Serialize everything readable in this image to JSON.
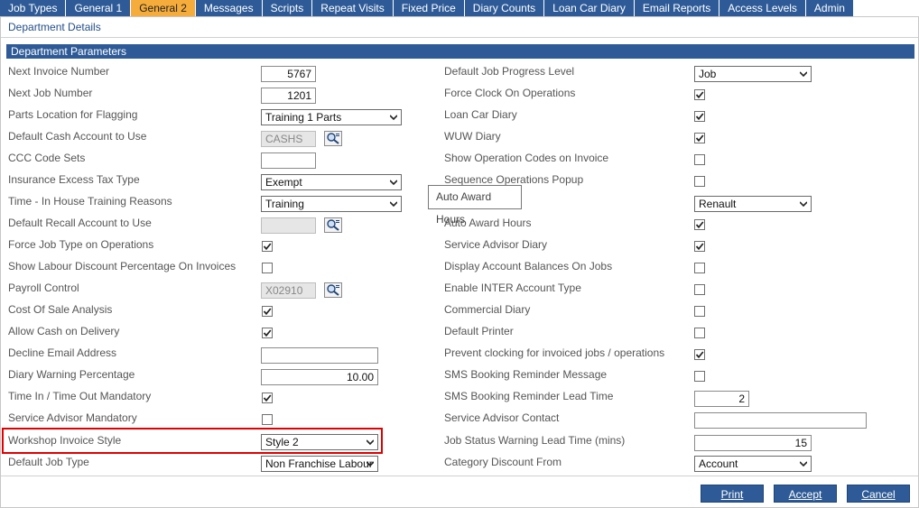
{
  "tabs": [
    "Job Types",
    "General 1",
    "General 2",
    "Messages",
    "Scripts",
    "Repeat Visits",
    "Fixed Price",
    "Diary Counts",
    "Loan Car Diary",
    "Email Reports",
    "Access Levels",
    "Admin"
  ],
  "panel_title": "Department Details",
  "section_title": "Department Parameters",
  "left": {
    "next_invoice_number": {
      "label": "Next Invoice Number",
      "value": "5767"
    },
    "next_job_number": {
      "label": "Next Job Number",
      "value": "1201"
    },
    "parts_location": {
      "label": "Parts Location for Flagging",
      "value": "Training 1 Parts"
    },
    "default_cash_account": {
      "label": "Default Cash Account to Use",
      "value": "CASHS"
    },
    "ccc_code_sets": {
      "label": "CCC Code Sets",
      "value": ""
    },
    "insurance_excess_tax": {
      "label": "Insurance Excess Tax Type",
      "value": "Exempt"
    },
    "time_in_house": {
      "label": "Time - In House Training Reasons",
      "value": "Training"
    },
    "default_recall_account": {
      "label": "Default Recall Account to Use",
      "value": ""
    },
    "force_job_type": {
      "label": "Force Job Type on Operations",
      "checked": true
    },
    "show_labour_discount": {
      "label": "Show Labour Discount Percentage On Invoices",
      "checked": false
    },
    "payroll_control": {
      "label": "Payroll Control",
      "value": "X02910"
    },
    "cost_of_sale": {
      "label": "Cost Of Sale Analysis",
      "checked": true
    },
    "allow_cash_on_delivery": {
      "label": "Allow Cash on Delivery",
      "checked": true
    },
    "decline_email": {
      "label": "Decline Email Address",
      "value": ""
    },
    "diary_warning": {
      "label": "Diary Warning Percentage",
      "value": "10.00"
    },
    "time_in_out": {
      "label": "Time In / Time Out Mandatory",
      "checked": true
    },
    "service_advisor_mandatory": {
      "label": "Service Advisor Mandatory",
      "checked": false
    },
    "workshop_invoice_style": {
      "label": "Workshop Invoice Style",
      "value": "Style 2"
    },
    "default_job_type": {
      "label": "Default Job Type",
      "value": "Non Franchise Labour"
    }
  },
  "right": {
    "default_job_progress": {
      "label": "Default Job Progress Level",
      "value": "Job"
    },
    "force_clock_on": {
      "label": "Force Clock On Operations",
      "checked": true
    },
    "loan_car_diary": {
      "label": "Loan Car Diary",
      "checked": true
    },
    "wuw_diary": {
      "label": "WUW Diary",
      "checked": true
    },
    "show_operation_codes": {
      "label": "Show Operation Codes on Invoice",
      "checked": false
    },
    "sequence_operations": {
      "label": "Sequence Operations Popup",
      "checked": false
    },
    "franchise_select": {
      "label": "",
      "value": "Renault"
    },
    "auto_award_hours": {
      "label": "Auto Award Hours",
      "checked": true
    },
    "service_advisor_diary": {
      "label": "Service Advisor Diary",
      "checked": true
    },
    "display_account_balances": {
      "label": "Display Account Balances On Jobs",
      "checked": false
    },
    "enable_inter": {
      "label": "Enable INTER Account Type",
      "checked": false
    },
    "commercial_diary": {
      "label": "Commercial Diary",
      "checked": false
    },
    "default_printer": {
      "label": "Default Printer",
      "checked": false
    },
    "prevent_clocking": {
      "label": "Prevent clocking for invoiced jobs / operations",
      "checked": true
    },
    "sms_booking_message": {
      "label": "SMS Booking Reminder Message",
      "checked": false
    },
    "sms_lead_time": {
      "label": "SMS Booking Reminder Lead Time",
      "value": "2"
    },
    "service_advisor_contact": {
      "label": "Service Advisor Contact",
      "value": ""
    },
    "job_status_warning": {
      "label": "Job Status Warning Lead Time (mins)",
      "value": "15"
    },
    "category_discount": {
      "label": "Category Discount From",
      "value": "Account"
    }
  },
  "tooltip": "Auto Award Hours",
  "buttons": {
    "print": "Print",
    "accept": "Accept",
    "cancel": "Cancel"
  },
  "icons": {
    "lookup": "magnifier-lookup-icon",
    "dropdown": "chevron-down-icon",
    "check": "checkmark-icon"
  },
  "colors": {
    "brand": "#2e5b97",
    "active_tab": "#f5ac3a",
    "highlight": "#e00000"
  }
}
